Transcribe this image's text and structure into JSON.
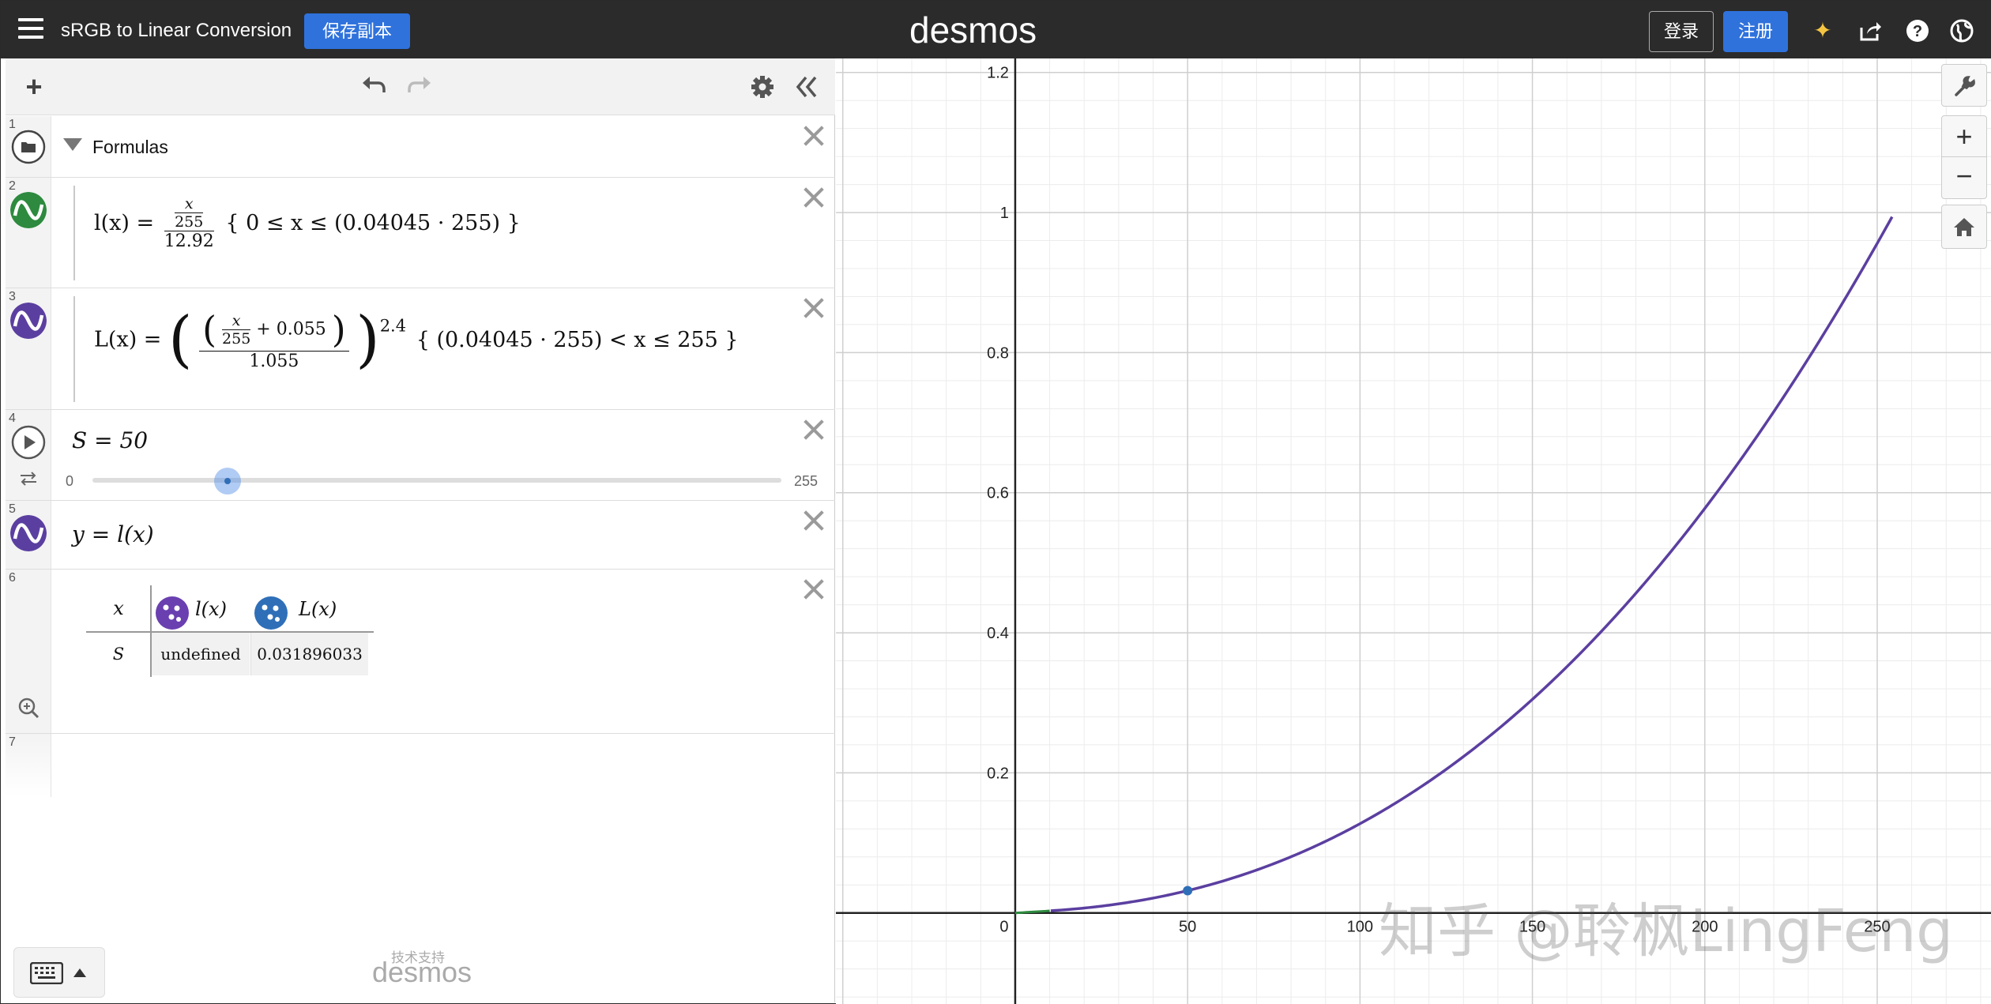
{
  "topbar": {
    "title": "sRGB to Linear Conversion",
    "save_copy": "保存副本",
    "brand": "desmos",
    "login": "登录",
    "signup": "注册"
  },
  "expressions": [
    {
      "index": "1",
      "type": "folder",
      "label": "Formulas"
    },
    {
      "index": "2",
      "type": "function",
      "color": "#2d8a3e",
      "lhs": "l(x) =",
      "frac_top_num": "x",
      "frac_top_den": "255",
      "frac_den": "12.92",
      "domain": "{ 0 ≤ x ≤ (0.04045 · 255) }"
    },
    {
      "index": "3",
      "type": "function",
      "color": "#5b3fa0",
      "lhs": "L(x) =",
      "inner_num": "x",
      "inner_den": "255",
      "plus": "+ 0.055",
      "den": "1.055",
      "exponent": "2.4",
      "domain": "{ (0.04045 · 255) < x ≤ 255 }"
    },
    {
      "index": "4",
      "type": "slider",
      "label": "S = 50",
      "value": 50,
      "min_label": "0",
      "max_label": "255",
      "min": 0,
      "max": 255
    },
    {
      "index": "5",
      "type": "function",
      "color": "#5b3fa0",
      "label": "y = l(x)"
    },
    {
      "index": "6",
      "type": "table",
      "headers": [
        "x",
        "l(x)",
        "L(x)"
      ],
      "header_colors": [
        "",
        "#6a3fb0",
        "#2f6fb8"
      ],
      "rows": [
        [
          "S",
          "undefined",
          "0.031896033"
        ]
      ]
    },
    {
      "index": "7",
      "type": "empty"
    }
  ],
  "panel_footer": {
    "powered_by": "技术支持",
    "logo": "desmos"
  },
  "graph": {
    "x_range": [
      -52,
      283
    ],
    "y_range": [
      -0.13,
      1.22
    ],
    "x_tick_labels": [
      "0",
      "50",
      "100",
      "150",
      "200",
      "250"
    ],
    "x_tick_values": [
      0,
      50,
      100,
      150,
      200,
      250
    ],
    "y_tick_labels": [
      "0.2",
      "0.4",
      "0.6",
      "0.8",
      "1",
      "1.2"
    ],
    "y_tick_values": [
      0.2,
      0.4,
      0.6,
      0.8,
      1.0,
      1.2
    ],
    "curve_color": "#5b3fa0",
    "point_color": "#2f6fb8",
    "point": {
      "x": 50,
      "y": 0.031896033
    }
  },
  "watermark": "知乎 @聆枫LingFeng"
}
